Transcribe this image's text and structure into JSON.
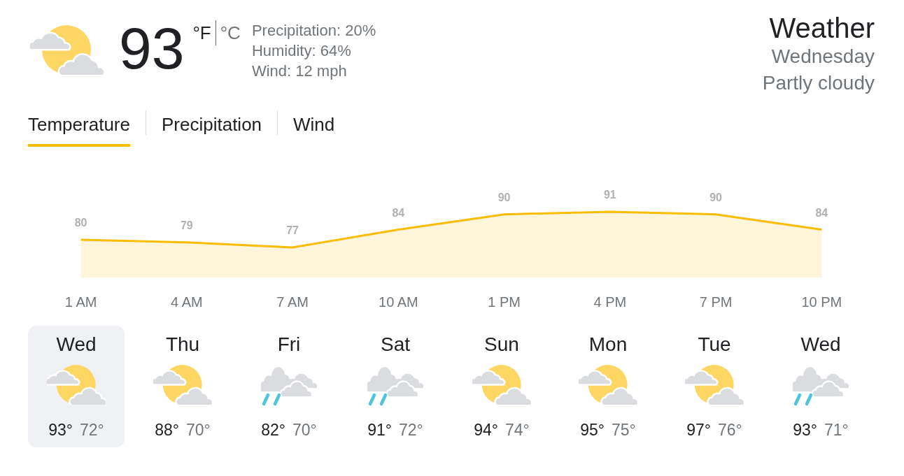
{
  "current": {
    "kind": "partly_cloudy",
    "temperature": "93",
    "units": [
      {
        "label": "°F",
        "selected": true
      },
      {
        "label": "°C",
        "selected": false
      }
    ],
    "details": [
      "Precipitation: 20%",
      "Humidity: 64%",
      "Wind: 12 mph"
    ]
  },
  "summary": {
    "title": "Weather",
    "day": "Wednesday",
    "condition": "Partly cloudy"
  },
  "tabs": [
    {
      "label": "Temperature",
      "selected": true
    },
    {
      "label": "Precipitation",
      "selected": false
    },
    {
      "label": "Wind",
      "selected": false
    }
  ],
  "forecast_chart": {
    "chart_data": {
      "type": "area",
      "categories": [
        "1 AM",
        "4 AM",
        "7 AM",
        "10 AM",
        "1 PM",
        "4 PM",
        "7 PM",
        "10 PM"
      ],
      "values": [
        80,
        79,
        77,
        84,
        90,
        91,
        90,
        84
      ],
      "data_labels": true
    }
  },
  "days": [
    {
      "day": "Wed",
      "kind": "partly_cloudy",
      "high": "93°",
      "low": "72°",
      "selected": true
    },
    {
      "day": "Thu",
      "kind": "partly_cloudy",
      "high": "88°",
      "low": "70°",
      "selected": false
    },
    {
      "day": "Fri",
      "kind": "rain",
      "high": "82°",
      "low": "70°",
      "selected": false
    },
    {
      "day": "Sat",
      "kind": "rain",
      "high": "91°",
      "low": "72°",
      "selected": false
    },
    {
      "day": "Sun",
      "kind": "partly_cloudy",
      "high": "94°",
      "low": "74°",
      "selected": false
    },
    {
      "day": "Mon",
      "kind": "partly_cloudy",
      "high": "95°",
      "low": "75°",
      "selected": false
    },
    {
      "day": "Tue",
      "kind": "partly_cloudy",
      "high": "97°",
      "low": "76°",
      "selected": false
    },
    {
      "day": "Wed",
      "kind": "rain",
      "high": "93°",
      "low": "71°",
      "selected": false
    }
  ]
}
